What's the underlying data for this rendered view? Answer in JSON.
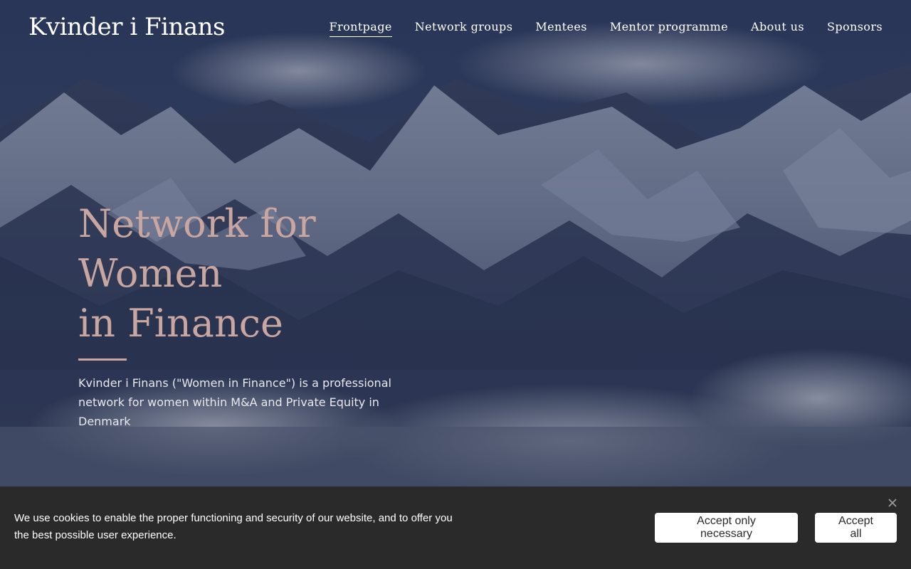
{
  "header": {
    "logo": "Kvinder i Finans",
    "nav": [
      {
        "label": "Frontpage",
        "active": true
      },
      {
        "label": "Network groups",
        "active": false
      },
      {
        "label": "Mentees",
        "active": false
      },
      {
        "label": "Mentor programme",
        "active": false
      },
      {
        "label": "About us",
        "active": false
      },
      {
        "label": "Sponsors",
        "active": false
      }
    ]
  },
  "hero": {
    "title_line1": "Network for Women",
    "title_line2": "in Finance",
    "subtitle": "Kvinder i Finans (\"Women in Finance\") is a professional network for women within M&A and Private Equity in Denmark",
    "accent_color": "#c9a6a0"
  },
  "cookie_banner": {
    "text": "We use cookies to enable the proper functioning and security of our website, and to offer you the best possible user experience.",
    "accept_necessary_label": "Accept only necessary",
    "accept_all_label": "Accept all",
    "close_icon": "close-icon"
  }
}
